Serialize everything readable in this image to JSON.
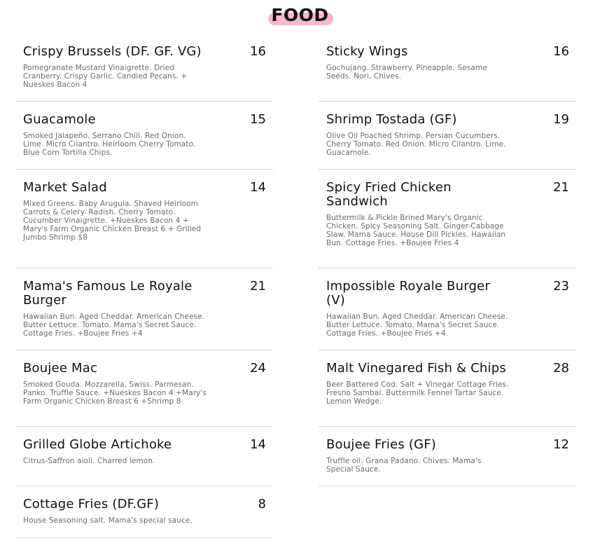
{
  "header": {
    "title": "FOOD"
  },
  "left_items": [
    {
      "name": "Crispy Brussels (DF. GF. VG)",
      "price": "16",
      "description": "Pomegranate Mustard Vinaigrette. Dried Cranberry. Crispy Garlic. Candied Pecans. + Nueskes Bacon 4"
    },
    {
      "name": "Guacamole",
      "price": "15",
      "description": "Smoked Jalapeño. Serrano Chili. Red Onion. Lime. Micro Cilantro. Heirloom Cherry Tomato. Blue Corn Tortilla Chips."
    },
    {
      "name": "Market Salad",
      "price": "14",
      "description": "Mixed Greens. Baby Arugula. Shaved Heirloom Carrots & Celery. Radish. Cherry Tomato. Cucumber Vinaigrette. +Nueskes Bacon 4 + Mary's Farm Organic Chicken Breast 6 + Grilled Jumbo Shrimp $8"
    },
    {
      "name": "Mama's Famous Le Royale Burger",
      "price": "21",
      "description": "Hawaiian Bun. Aged Cheddar. American Cheese. Butter Lettuce. Tomato. Mama's Secret Sauce. Cottage Fries. +Boujee Fries +4"
    },
    {
      "name": "Boujee Mac",
      "price": "24",
      "description": "Smoked Gouda. Mozzarella. Swiss. Parmesan. Panko. Truffle Sauce. +Nueskes Bacon 4 +Mary's Farm Organic Chicken Breast 6 +Shrimp 8"
    },
    {
      "name": "Grilled Globe Artichoke",
      "price": "14",
      "description": "Citrus-Saffron aioli. Charred lemon."
    },
    {
      "name": "Cottage Fries (DF.GF)",
      "price": "8",
      "description": "House Seasoning salt. Mama's special sauce."
    }
  ],
  "right_items": [
    {
      "name": "Sticky Wings",
      "price": "16",
      "description": "Gochujang. Strawberry. Pineapple. Sesame Seeds. Nori. Chives."
    },
    {
      "name": "Shrimp Tostada (GF)",
      "price": "19",
      "description": "Olive Oil Poached Shrimp. Persian Cucumbers. Cherry Tomato. Red Onion. Micro Cilantro. Lime. Guacamole."
    },
    {
      "name": "Spicy Fried Chicken Sandwich",
      "price": "21",
      "description": "Buttermilk & Pickle Brined Mary's Organic Chicken. Spicy Seasoning Salt. Ginger-Cabbage Slaw. Mama Sauce. House Dill Pickles. Hawaiian Bun. Cottage Fries. +Boujee Fries 4"
    },
    {
      "name": "Impossible Royale Burger (V)",
      "price": "23",
      "description": "Hawaiian Bun. Aged Cheddar. American Cheese. Butter Lettuce. Tomato. Mama's Secret Sauce. Cottage Fries. +Boujee Fries +4"
    },
    {
      "name": "Malt Vinegared Fish & Chips",
      "price": "28",
      "description": "Beer Battered Cod. Salt + Vinegar Cottage Fries. Fresno Sambal. Buttermilk Fennel Tartar Sauce. Lemon Wedge."
    },
    {
      "name": "Boujee Fries (GF)",
      "price": "12",
      "description": "Truffle oil. Grana Padano. Chives. Mama's Special Sauce."
    }
  ]
}
